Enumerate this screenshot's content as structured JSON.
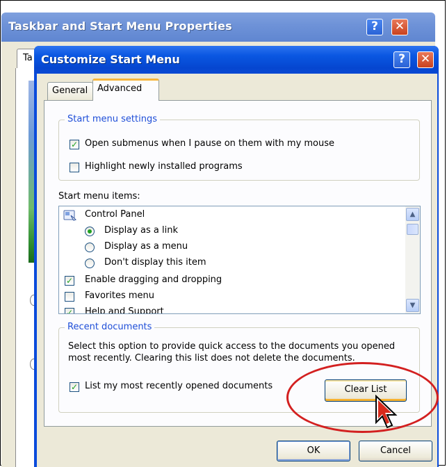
{
  "background_dialog": {
    "title": "Taskbar and Start Menu Properties",
    "tab_label_visible": "Ta",
    "help_glyph": "?",
    "close_glyph": "✕"
  },
  "dialog": {
    "title": "Customize Start Menu",
    "help_glyph": "?",
    "close_glyph": "✕",
    "tabs": [
      {
        "label": "General",
        "selected": false
      },
      {
        "label": "Advanced",
        "selected": true
      }
    ],
    "start_menu_settings": {
      "label": "Start menu settings",
      "options": [
        {
          "label": "Open submenus when I pause on them with my mouse",
          "checked": true
        },
        {
          "label": "Highlight newly installed programs",
          "checked": false
        }
      ]
    },
    "start_menu_items": {
      "label": "Start menu items:",
      "items": [
        {
          "type": "folder",
          "label": "Control Panel",
          "icon": "control-panel-icon"
        },
        {
          "type": "radio",
          "label": "Display as a link",
          "checked": true
        },
        {
          "type": "radio",
          "label": "Display as a menu",
          "checked": false
        },
        {
          "type": "radio",
          "label": "Don't display this item",
          "checked": false
        },
        {
          "type": "checkbox",
          "label": "Enable dragging and dropping",
          "checked": true
        },
        {
          "type": "checkbox",
          "label": "Favorites menu",
          "checked": false
        },
        {
          "type": "checkbox",
          "label": "Help and Support",
          "checked": true
        }
      ]
    },
    "recent_documents": {
      "label": "Recent documents",
      "description": "Select this option to provide quick access to the documents you opened most recently.  Clearing this list does not delete the documents.",
      "option": {
        "label": "List my most recently opened documents",
        "checked": true
      },
      "clear_button": "Clear List"
    },
    "buttons": {
      "ok": "OK",
      "cancel": "Cancel"
    }
  },
  "colors": {
    "title_blue": "#0a57e2",
    "group_label_blue": "#1e4ed8",
    "check_green": "#21a121",
    "annotation_red": "#d32020"
  }
}
